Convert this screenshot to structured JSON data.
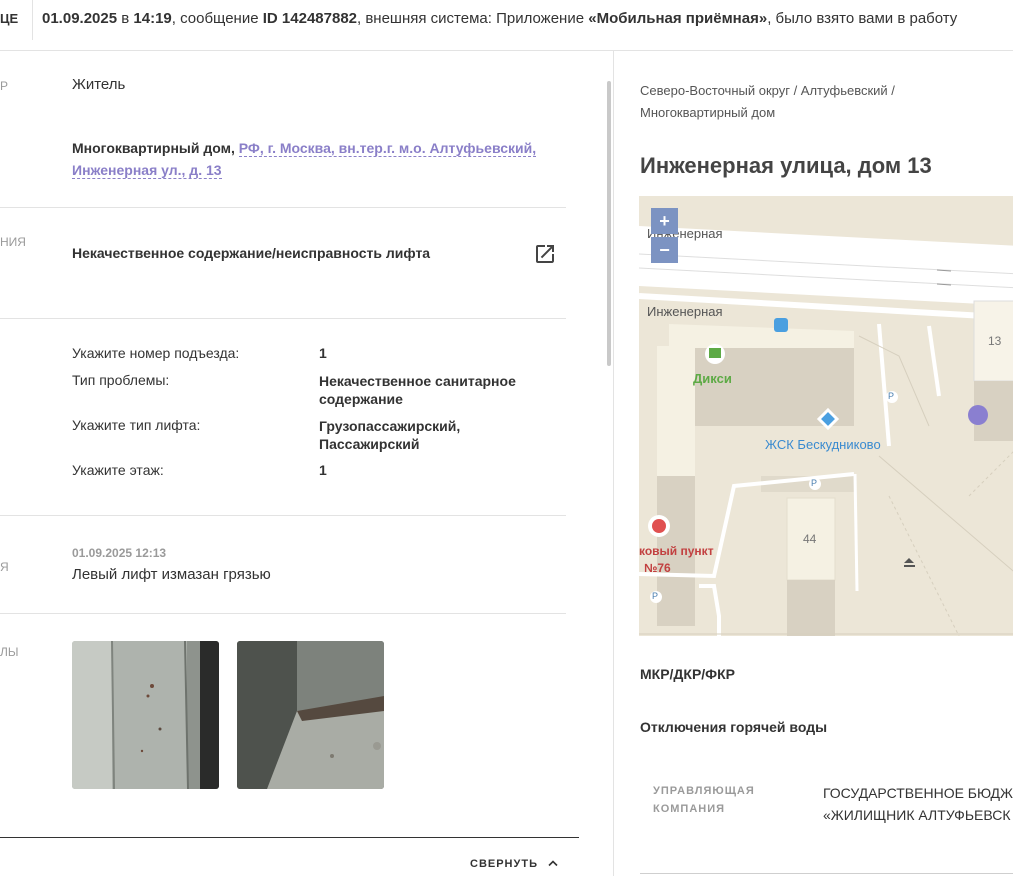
{
  "topbar": {
    "cut_label": "ЦЕ",
    "date": "01.09.2025",
    "in": "в",
    "time": "14:19",
    "msg_word": ", сообщение",
    "id_label": "ID 142487882",
    "rest": ", внешняя система: Приложение",
    "app_name": "«Мобильная приёмная»",
    "tail": ", было взято вами в работу"
  },
  "left": {
    "applicant_label_cut": "Р",
    "applicant_value": "Житель",
    "object_type": "Многоквартирный дом,",
    "object_address_line1": "РФ, г. Москва, вн.тер.г. м.о. Алтуфьевский,",
    "object_address_line2": "Инженерная ул., д. 13",
    "topic_label_cut": "НИЯ",
    "topic_value": "Некачественное содержание/неисправность лифта",
    "details": [
      {
        "label": "Укажите номер подъезда:",
        "value": "1"
      },
      {
        "label": "Тип проблемы:",
        "value": "Некачественное санитарное содержание"
      },
      {
        "label": "Укажите тип лифта:",
        "value": "Грузопассажирский, Пассажирский"
      },
      {
        "label": "Укажите этаж:",
        "value": "1"
      }
    ],
    "comment_label_cut": "Я",
    "comment_date": "01.09.2025 12:13",
    "comment_text": "Левый лифт измазан грязью",
    "files_label_cut": "ЛЫ",
    "collapse_label": "СВЕРНУТЬ"
  },
  "right": {
    "breadcrumb": "Северо-Восточный округ / Алтуфьевский / Многоквартирный дом",
    "address_title": "Инженерная улица, дом 13",
    "map": {
      "zoom_in": "+",
      "zoom_out": "−",
      "street1": "Инженерная",
      "street2": "Инженерная",
      "shop": "Дикси",
      "poi": "ЖСК Бескудниково",
      "building13": "13",
      "building44": "44",
      "poi2_line1": "ковый пункт",
      "poi2_line2": "№76",
      "parking": "P"
    },
    "section1": "МКР/ДКР/ФКР",
    "section2": "Отключения горячей воды",
    "uk_label_line1": "УПРАВЛЯЮЩАЯ",
    "uk_label_line2": "КОМПАНИЯ",
    "uk_value_line1": "ГОСУДАРСТВЕННОЕ БЮДЖ",
    "uk_value_line2": "«ЖИЛИЩНИК АЛТУФЬЕВСК"
  },
  "colors": {
    "link": "#8a7fc8",
    "map_bg": "#ece6d7",
    "zoom_button": "#7c93c2",
    "marker": "#8a7fd0"
  }
}
